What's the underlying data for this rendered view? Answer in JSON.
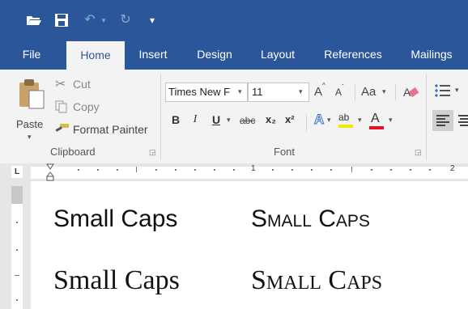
{
  "quick_access": {
    "icons": [
      "folder-open-icon",
      "save-icon",
      "undo-icon",
      "redo-icon",
      "customize-qat-icon"
    ],
    "undo_glyph": "↶",
    "redo_glyph": "↻",
    "customize_glyph": "▾"
  },
  "tabs": [
    "File",
    "Home",
    "Insert",
    "Design",
    "Layout",
    "References",
    "Mailings"
  ],
  "active_tab": "Home",
  "clipboard": {
    "paste_label": "Paste",
    "cut_label": "Cut",
    "copy_label": "Copy",
    "format_painter_label": "Format Painter",
    "group_label": "Clipboard"
  },
  "font": {
    "font_name": "Times New F",
    "font_size": "11",
    "grow_label": "A",
    "shrink_label": "A",
    "change_case_label": "Aa",
    "bold_label": "B",
    "italic_label": "I",
    "underline_label": "U",
    "strikethrough_label": "abc",
    "subscript_label": "x₂",
    "superscript_label": "x²",
    "text_effects_label": "A",
    "highlight_label": "ab",
    "font_color_label": "A",
    "group_label": "Font"
  },
  "ruler": {
    "left_marker": "L",
    "numbers": [
      "1",
      "2"
    ]
  },
  "document": {
    "line1_normal": "Small Caps",
    "line1_smallcaps": "Small Caps",
    "line2_normal": "Small Caps",
    "line2_smallcaps": "Small Caps"
  },
  "colors": {
    "ribbon_blue": "#2b579a",
    "highlight_yellow": "#f5e800",
    "font_red": "#e81123"
  }
}
